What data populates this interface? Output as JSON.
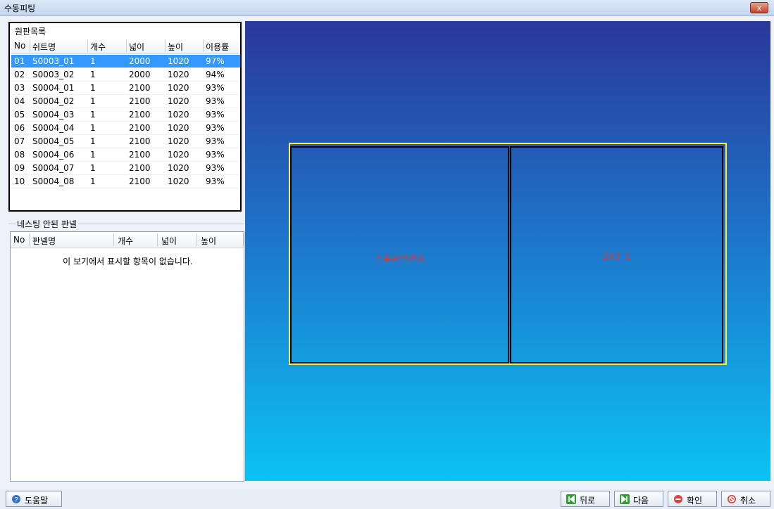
{
  "window": {
    "title": "수동피팅",
    "close_glyph": "x"
  },
  "sheets": {
    "group_label": "원판목록",
    "columns": [
      "No",
      "쉬트명",
      "개수",
      "넓이",
      "높이",
      "이용률"
    ],
    "rows": [
      [
        "01",
        "S0003_01",
        "1",
        "2000",
        "1020",
        "97%"
      ],
      [
        "02",
        "S0003_02",
        "1",
        "2000",
        "1020",
        "94%"
      ],
      [
        "03",
        "S0004_01",
        "1",
        "2100",
        "1020",
        "93%"
      ],
      [
        "04",
        "S0004_02",
        "1",
        "2100",
        "1020",
        "93%"
      ],
      [
        "05",
        "S0004_03",
        "1",
        "2100",
        "1020",
        "93%"
      ],
      [
        "06",
        "S0004_04",
        "1",
        "2100",
        "1020",
        "93%"
      ],
      [
        "07",
        "S0004_05",
        "1",
        "2100",
        "1020",
        "93%"
      ],
      [
        "08",
        "S0004_06",
        "1",
        "2100",
        "1020",
        "93%"
      ],
      [
        "09",
        "S0004_07",
        "1",
        "2100",
        "1020",
        "93%"
      ],
      [
        "10",
        "S0004_08",
        "1",
        "2100",
        "1020",
        "93%"
      ]
    ],
    "selected_index": 0
  },
  "unnested": {
    "group_label": "네스팅 안된 판넬",
    "columns": [
      "No",
      "판넬명",
      "개수",
      "넓이",
      "높이"
    ],
    "empty_text": "이 보기에서 표시할 항목이 없습니다."
  },
  "canvas": {
    "panel1_label": "수동판넬연습",
    "panel2_label": "2X3_1",
    "sheet_outline_color": "#ffee33",
    "label_color": "#d23a3a"
  },
  "footer": {
    "help": "도움말",
    "back": "뒤로",
    "next": "다음",
    "ok": "확인",
    "cancel": "취소"
  }
}
